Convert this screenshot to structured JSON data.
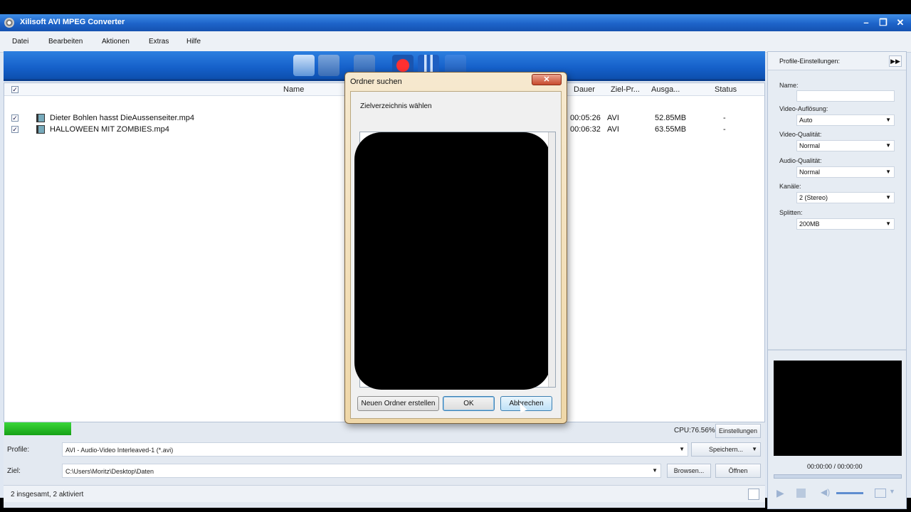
{
  "window": {
    "title": "Xilisoft AVI MPEG Converter"
  },
  "menu": [
    "Datei",
    "Bearbeiten",
    "Aktionen",
    "Extras",
    "Hilfe"
  ],
  "toolbar": {
    "icons": [
      "add-file-icon",
      "add-folder-icon",
      "list-icon",
      "record-icon",
      "pause-icon",
      "stop-icon"
    ]
  },
  "columns": {
    "name": "Name",
    "dauer": "Dauer",
    "ziel": "Ziel-Pr...",
    "ausgabe": "Ausga...",
    "status": "Status"
  },
  "files": [
    {
      "name": "Dieter Bohlen hasst DieAussenseiter.mp4",
      "dauer": "00:05:26",
      "ziel": "AVI",
      "ausgabe": "52.85MB",
      "status": "-"
    },
    {
      "name": "HALLOWEEN MIT ZOMBIES.mp4",
      "dauer": "00:06:32",
      "ziel": "AVI",
      "ausgabe": "63.55MB",
      "status": "-"
    }
  ],
  "bottom": {
    "cpu": "CPU:76.56%",
    "einstellungen": "Einstellungen",
    "profile_label": "Profile:",
    "profile_value": "AVI - Audio-Video Interleaved-1 (*.avi)",
    "speichern": "Speichern...",
    "ziel_label": "Ziel:",
    "ziel_value": "C:\\Users\\Moritz\\Desktop\\Daten",
    "browsen": "Browsen...",
    "oeffnen": "Öffnen",
    "status": "2 insgesamt, 2 aktiviert"
  },
  "right": {
    "header": "Profile-Einstellungen:",
    "name_label": "Name:",
    "name_value": "",
    "fields": [
      {
        "label": "Video-Auflösung:",
        "value": "Auto"
      },
      {
        "label": "Video-Qualität:",
        "value": "Normal"
      },
      {
        "label": "Audio-Qualität:",
        "value": "Normal"
      },
      {
        "label": "Kanäle:",
        "value": "2 (Stereo)"
      },
      {
        "label": "Splitten:",
        "value": "200MB"
      }
    ],
    "time": "00:00:00 / 00:00:00"
  },
  "dialog": {
    "title": "Ordner suchen",
    "prompt": "Zielverzeichnis wählen",
    "new_folder": "Neuen Ordner erstellen",
    "ok": "OK",
    "cancel": "Abbrechen"
  }
}
